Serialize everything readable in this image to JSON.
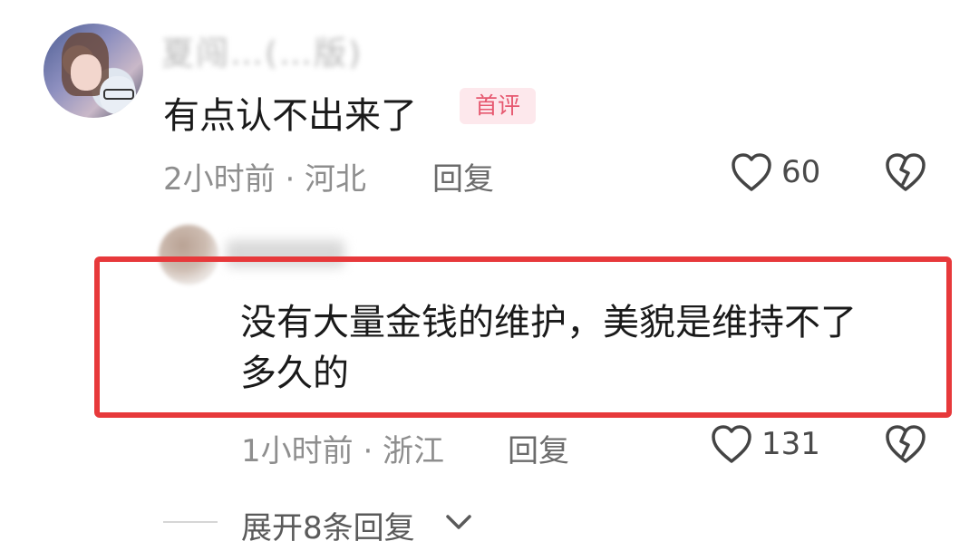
{
  "comment1": {
    "username": "夏闯…(…版)",
    "text": "有点认不出来了",
    "badge": "首评",
    "time_location": "2小时前 · 河北",
    "reply_label": "回复",
    "likes": "60"
  },
  "comment2": {
    "text_line1": "没有大量金钱的维护，美貌是维持不了",
    "text_line2": "多久的",
    "time_location": "1小时前 · 浙江",
    "reply_label": "回复",
    "likes": "131"
  },
  "expand_replies": "展开8条回复",
  "icons": {
    "like": "heart-outline-icon",
    "dislike": "broken-heart-icon",
    "expand": "chevron-down-icon"
  },
  "colors": {
    "badge_bg": "#fde8ec",
    "badge_text": "#e6586f",
    "highlight_box": "#e7393b"
  }
}
